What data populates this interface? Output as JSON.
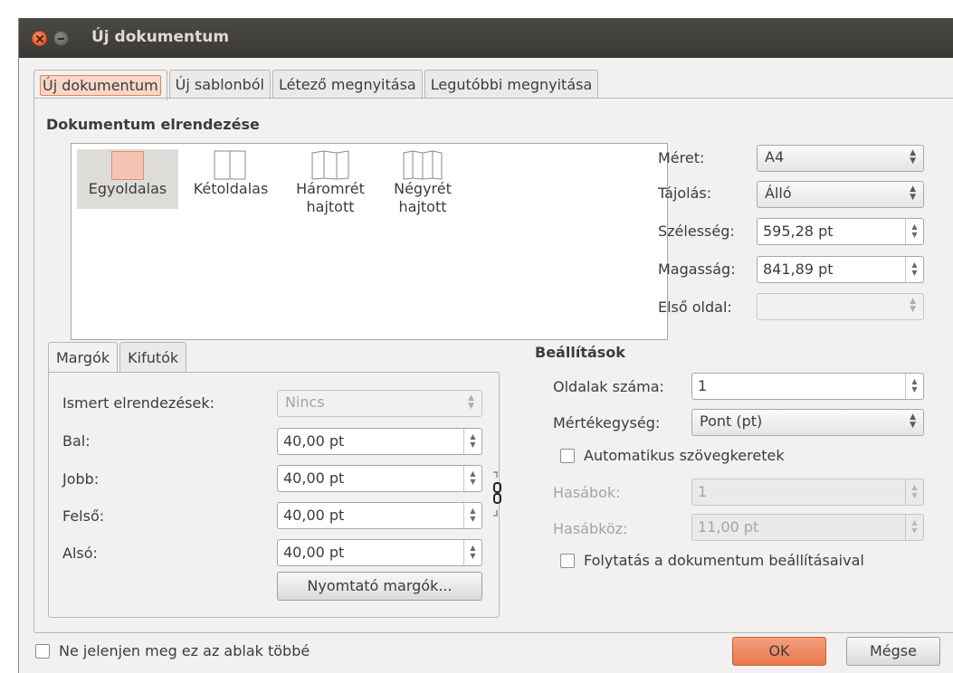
{
  "window": {
    "title": "Új dokumentum"
  },
  "tabs": [
    {
      "label": "Új dokumentum",
      "active": true
    },
    {
      "label": "Új sablonból",
      "active": false
    },
    {
      "label": "Létező megnyitása",
      "active": false
    },
    {
      "label": "Legutóbbi megnyitása",
      "active": false
    }
  ],
  "document_layout": {
    "title": "Dokumentum elrendezése",
    "options": [
      {
        "line1": "Egyoldalas",
        "line2": "",
        "selected": true,
        "icon": "single-page-icon"
      },
      {
        "line1": "Kétoldalas",
        "line2": "",
        "selected": false,
        "icon": "double-page-icon"
      },
      {
        "line1": "Háromrét",
        "line2": "hajtott",
        "selected": false,
        "icon": "three-fold-icon"
      },
      {
        "line1": "Négyrét",
        "line2": "hajtott",
        "selected": false,
        "icon": "four-fold-icon"
      }
    ]
  },
  "page_settings": {
    "size_label": "Méret:",
    "size_value": "A4",
    "orientation_label": "Tájolás:",
    "orientation_value": "Álló",
    "width_label": "Szélesség:",
    "width_value": "595,28 pt",
    "height_label": "Magasság:",
    "height_value": "841,89 pt",
    "first_page_label": "Első oldal:",
    "first_page_value": ""
  },
  "margins": {
    "tabs": [
      {
        "label": "Margók",
        "active": true
      },
      {
        "label": "Kifutók",
        "active": false
      }
    ],
    "presets_label": "Ismert elrendezések:",
    "presets_value": "Nincs",
    "left_label": "Bal:",
    "left_value": "40,00 pt",
    "right_label": "Jobb:",
    "right_value": "40,00 pt",
    "top_label": "Felső:",
    "top_value": "40,00 pt",
    "bottom_label": "Alsó:",
    "bottom_value": "40,00 pt",
    "printer_margins_button": "Nyomtató margók..."
  },
  "settings": {
    "title": "Beállítások",
    "page_count_label": "Oldalak száma:",
    "page_count_value": "1",
    "unit_label": "Mértékegység:",
    "unit_value": "Pont (pt)",
    "auto_frames_label": "Automatikus szövegkeretek",
    "columns_label": "Hasábok:",
    "columns_value": "1",
    "gap_label": "Hasábköz:",
    "gap_value": "11,00 pt",
    "continue_label": "Folytatás a dokumentum beállításaival"
  },
  "footer": {
    "dont_show_label": "Ne jelenjen meg ez az ablak többé",
    "ok_label": "OK",
    "cancel_label": "Mégse"
  },
  "colors": {
    "accent": "#e9784b",
    "titlebar": "#3c3b37"
  }
}
